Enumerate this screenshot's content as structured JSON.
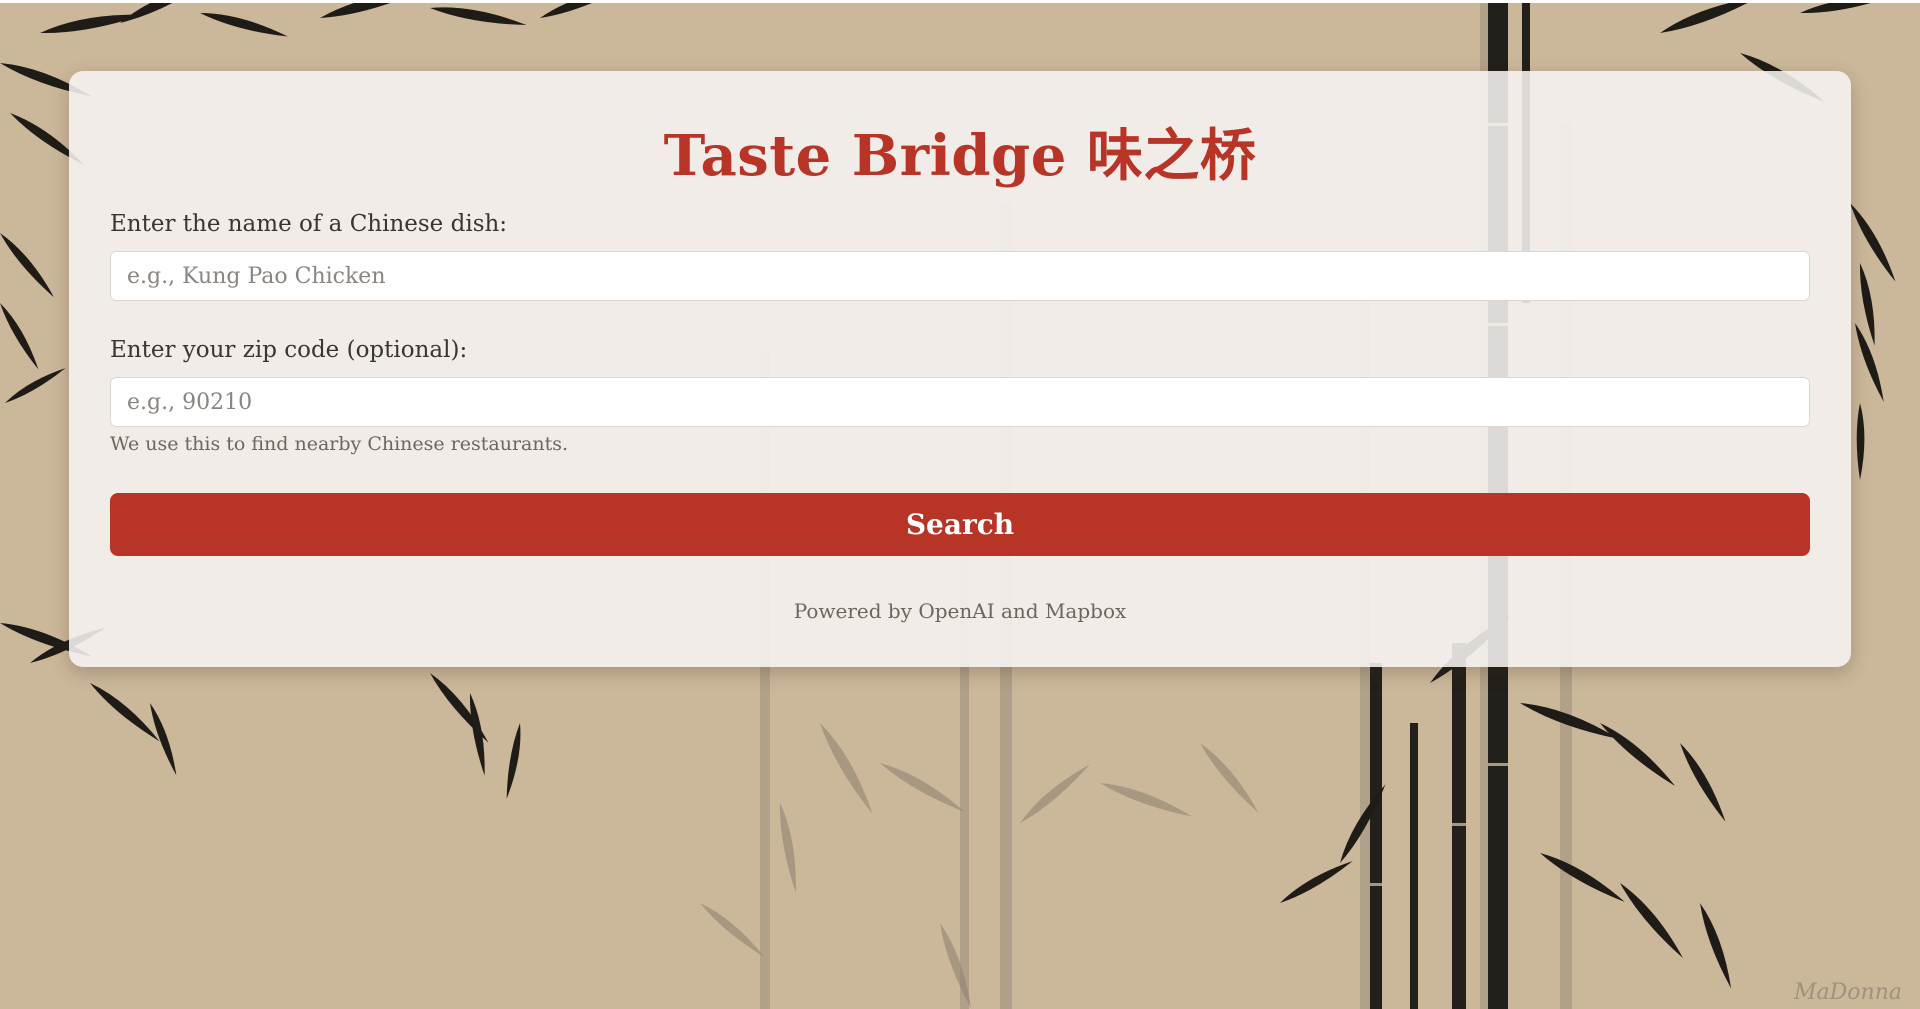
{
  "app": {
    "title": "Taste Bridge 味之桥"
  },
  "form": {
    "dish_label": "Enter the name of a Chinese dish:",
    "dish_placeholder": "e.g., Kung Pao Chicken",
    "dish_value": "",
    "zip_label": "Enter your zip code (optional):",
    "zip_placeholder": "e.g., 90210",
    "zip_value": "",
    "zip_hint": "We use this to find nearby Chinese restaurants.",
    "search_label": "Search"
  },
  "footer": {
    "text": "Powered by OpenAI and Mapbox"
  },
  "background": {
    "signature": "MaDonna"
  },
  "colors": {
    "accent": "#b83427",
    "background": "#cbb79a",
    "card": "#f6f4f1"
  }
}
